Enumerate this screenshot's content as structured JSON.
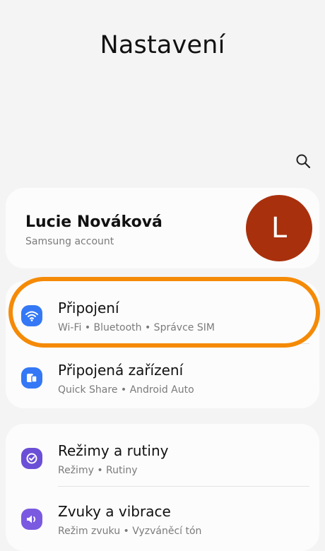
{
  "header": {
    "title": "Nastavení"
  },
  "account": {
    "name": "Lucie Nováková",
    "subtitle": "Samsung account",
    "avatar_initial": "L",
    "avatar_color": "#a9300d"
  },
  "groups": [
    {
      "items": [
        {
          "title": "Připojení",
          "subtitle": "Wi-Fi • Bluetooth • Správce SIM",
          "icon": "wifi-icon",
          "icon_color": "#3478f6"
        },
        {
          "title": "Připojená zařízení",
          "subtitle": "Quick Share • Android Auto",
          "icon": "connected-devices-icon",
          "icon_color": "#3478f6"
        }
      ]
    },
    {
      "items": [
        {
          "title": "Režimy a rutiny",
          "subtitle": "Režimy • Rutiny",
          "icon": "modes-routines-icon",
          "icon_color": "#6b4fd6"
        },
        {
          "title": "Zvuky a vibrace",
          "subtitle": "Režim zvuku • Vyzváněcí tón",
          "icon": "sound-icon",
          "icon_color": "#7a5ae0"
        }
      ]
    }
  ],
  "highlight_color": "#f58a07"
}
